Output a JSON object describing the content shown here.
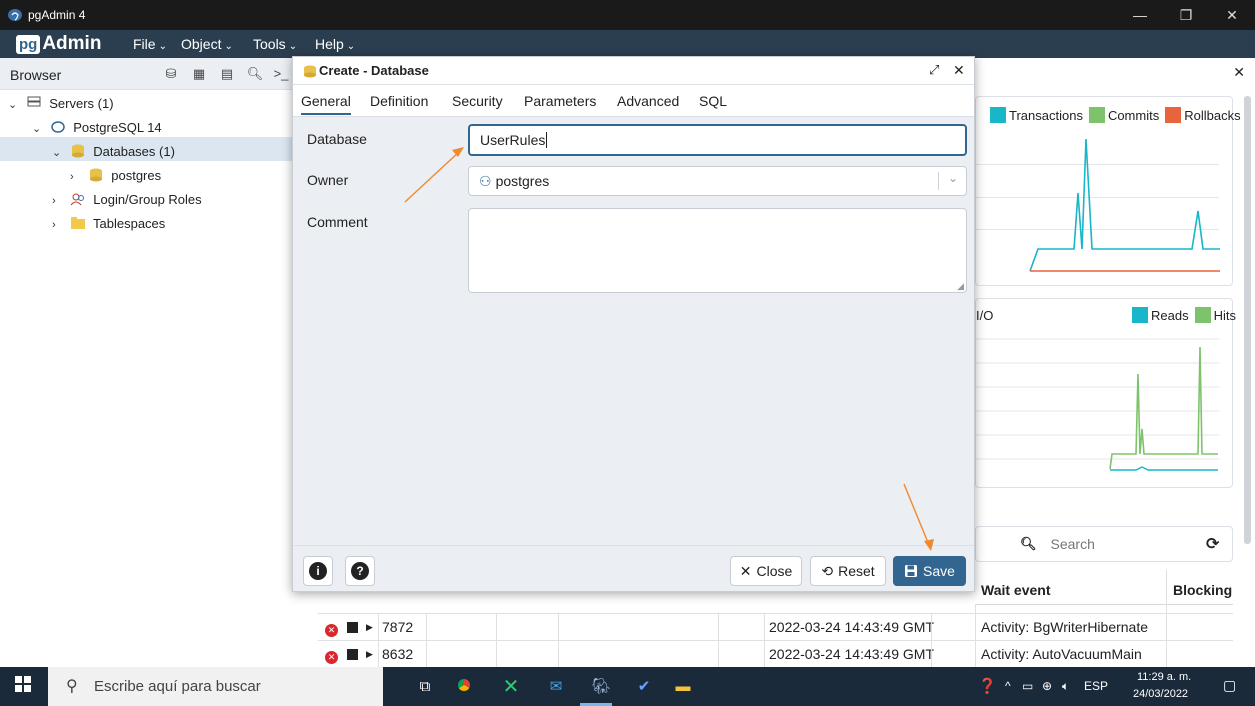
{
  "window": {
    "title": "pgAdmin 4",
    "min": "—",
    "max": "❐",
    "close": "✕"
  },
  "menubar": {
    "logo_pg": "pg",
    "logo_admin": "Admin",
    "items": [
      {
        "label": "File"
      },
      {
        "label": "Object"
      },
      {
        "label": "Tools"
      },
      {
        "label": "Help"
      }
    ]
  },
  "browser": {
    "title": "Browser",
    "tree": [
      {
        "label": "Servers (1)",
        "icon": "servers-icon",
        "arrow": "⌄"
      },
      {
        "label": "PostgreSQL 14",
        "icon": "postgresql-elephant-icon",
        "arrow": "⌄"
      },
      {
        "label": "Databases (1)",
        "icon": "databases-icon",
        "arrow": "⌄"
      },
      {
        "label": "postgres",
        "icon": "database-icon",
        "arrow": "›"
      },
      {
        "label": "Login/Group Roles",
        "icon": "roles-icon",
        "arrow": "›"
      },
      {
        "label": "Tablespaces",
        "icon": "tablespaces-icon",
        "arrow": "›"
      }
    ]
  },
  "dialog": {
    "title": "Create - Database",
    "tabs": [
      "General",
      "Definition",
      "Security",
      "Parameters",
      "Advanced",
      "SQL"
    ],
    "active_tab": "General",
    "fields": {
      "database_label": "Database",
      "database_value": "UserRules",
      "owner_label": "Owner",
      "owner_value": "postgres",
      "comment_label": "Comment",
      "comment_value": ""
    },
    "buttons": {
      "close": "Close",
      "reset": "Reset",
      "save": "Save"
    }
  },
  "dashboard": {
    "tx_legend": [
      "Transactions",
      "Commits",
      "Rollbacks"
    ],
    "io_title": "I/O",
    "io_legend": [
      "Reads",
      "Hits"
    ],
    "search_placeholder": "Search",
    "col_wait_event": "Wait event",
    "col_blocking": "Blocking"
  },
  "activity_rows": [
    {
      "pid": "7872",
      "backend_start": "2022-03-24 14:43:49 GMT",
      "wait_event": "Activity: BgWriterHibernate"
    },
    {
      "pid": "8632",
      "backend_start": "2022-03-24 14:43:49 GMT",
      "wait_event": "Activity: AutoVacuumMain"
    }
  ],
  "taskbar": {
    "search_text": "Escribe aquí para buscar",
    "language": "ESP",
    "time": "11:29 a. m.",
    "date": "24/03/2022"
  },
  "colors": {
    "accent": "#326690",
    "transactions": "#17b6c8",
    "commits": "#7dc36b",
    "rollbacks": "#e8643c",
    "annotation_arrow": "#ef8a2e"
  }
}
